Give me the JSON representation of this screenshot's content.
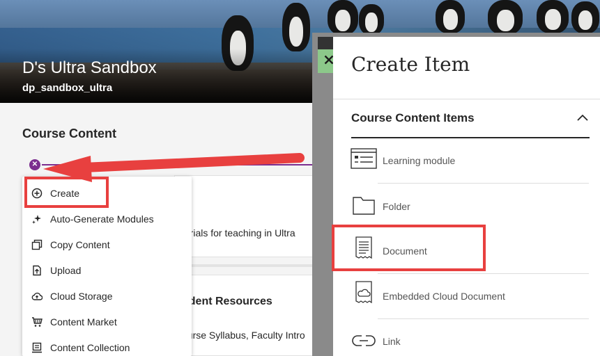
{
  "course": {
    "name": "D's Ultra Sandbox",
    "id": "dp_sandbox_ultra"
  },
  "section": {
    "title": "Course Content"
  },
  "cards": {
    "card1_text": "terials for teaching in Ultra",
    "card2_title": "udent Resources",
    "card2_text": "ourse Syllabus, Faculty Intro"
  },
  "add_menu": {
    "items": [
      {
        "label": "Create",
        "icon": "plus-circle-icon"
      },
      {
        "label": "Auto-Generate Modules",
        "icon": "sparkle-icon"
      },
      {
        "label": "Copy Content",
        "icon": "copy-icon"
      },
      {
        "label": "Upload",
        "icon": "upload-icon"
      },
      {
        "label": "Cloud Storage",
        "icon": "cloud-upload-icon"
      },
      {
        "label": "Content Market",
        "icon": "market-icon"
      },
      {
        "label": "Content Collection",
        "icon": "collection-icon"
      }
    ]
  },
  "create_panel": {
    "title": "Create Item",
    "close_icon": "close-icon",
    "group_title": "Course Content Items",
    "items": [
      {
        "label": "Learning module",
        "icon": "learning-module-icon"
      },
      {
        "label": "Folder",
        "icon": "folder-icon"
      },
      {
        "label": "Document",
        "icon": "document-icon"
      },
      {
        "label": "Embedded Cloud Document",
        "icon": "cloud-document-icon"
      },
      {
        "label": "Link",
        "icon": "link-icon"
      }
    ]
  },
  "colors": {
    "accent": "#7b2d8f",
    "highlight": "#e8403f",
    "close_button": "#8cc88a"
  }
}
